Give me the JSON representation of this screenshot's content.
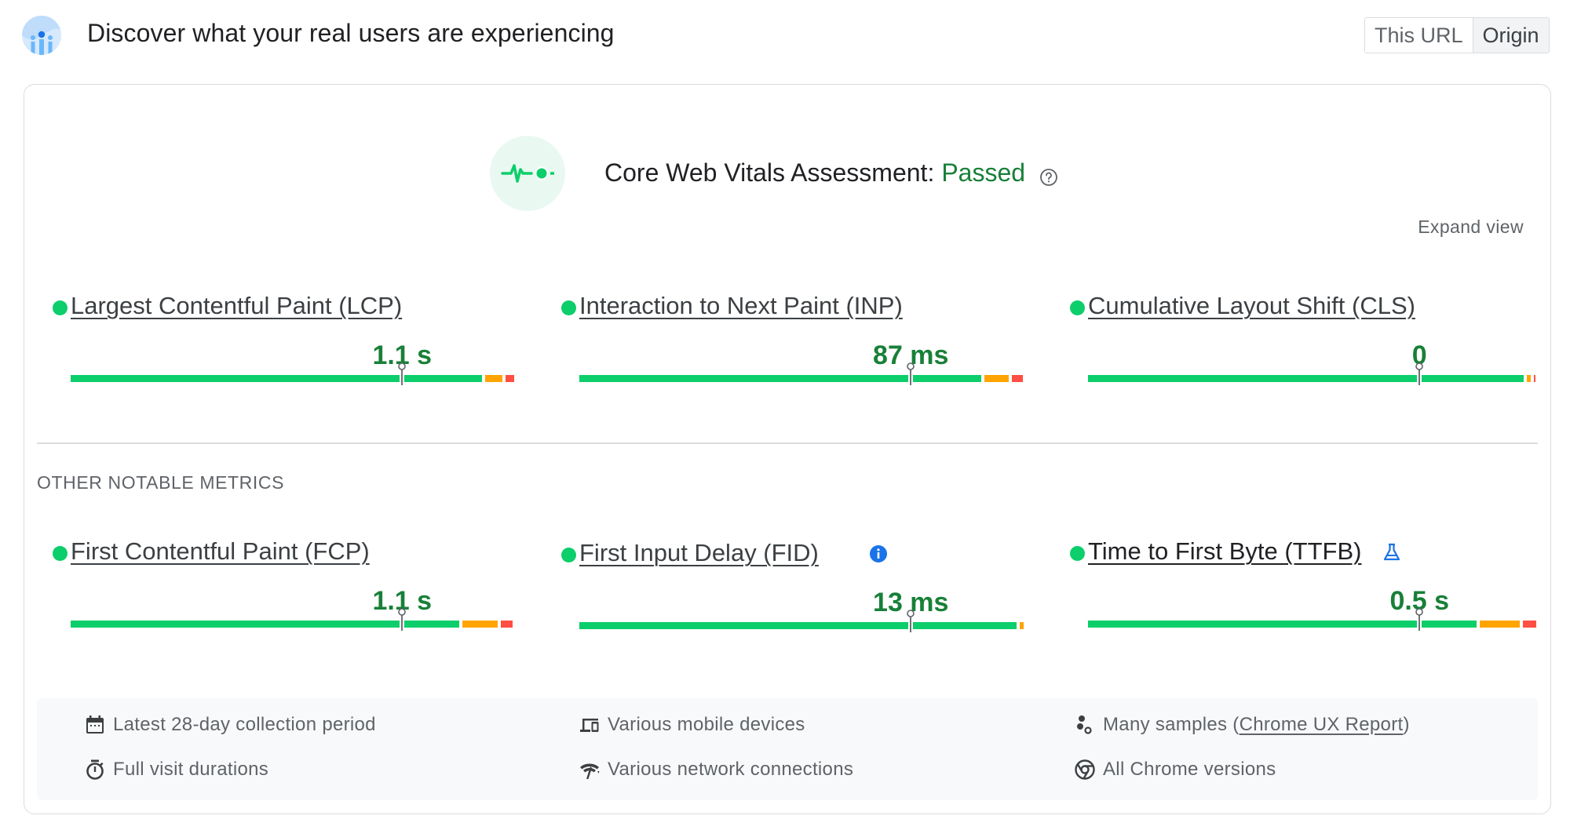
{
  "header": {
    "title": "Discover what your real users are experiencing",
    "logo_icon": "crux-users-icon",
    "toggle": [
      {
        "label": "This URL",
        "active": false
      },
      {
        "label": "Origin",
        "active": true
      }
    ]
  },
  "assessment": {
    "icon": "pulse-icon",
    "label": "Core Web Vitals Assessment:",
    "status": "Passed",
    "status_color": "#188038",
    "help_icon": "help-circle-icon",
    "expand_label": "Expand view"
  },
  "colors": {
    "good": "#0cce6b",
    "needs_improvement": "#ffa400",
    "poor": "#ff4e42",
    "value_text": "#188038"
  },
  "core_metrics": [
    {
      "name": "Largest Contentful Paint (LCP)",
      "value": "1.1 s",
      "rating": "good",
      "distribution": {
        "good": 0.93,
        "needs_improvement": 0.04,
        "poor": 0.02
      },
      "marker": 0.75
    },
    {
      "name": "Interaction to Next Paint (INP)",
      "value": "87 ms",
      "rating": "good",
      "distribution": {
        "good": 0.91,
        "needs_improvement": 0.055,
        "poor": 0.025
      },
      "marker": 0.75
    },
    {
      "name": "Cumulative Layout Shift (CLS)",
      "value": "0",
      "rating": "good",
      "distribution": {
        "good": 0.985,
        "needs_improvement": 0.01,
        "poor": 0.003
      },
      "marker": 0.75
    }
  ],
  "other_section_title": "OTHER NOTABLE METRICS",
  "other_metrics": [
    {
      "name": "First Contentful Paint (FCP)",
      "value": "1.1 s",
      "rating": "good",
      "distribution": {
        "good": 0.88,
        "needs_improvement": 0.08,
        "poor": 0.025
      },
      "marker": 0.75,
      "extra_icon": null
    },
    {
      "name": "First Input Delay (FID)",
      "value": "13 ms",
      "rating": "good",
      "distribution": {
        "good": 0.99,
        "needs_improvement": 0.008,
        "poor": 0.0
      },
      "marker": 0.75,
      "extra_icon": "info-icon"
    },
    {
      "name": "Time to First Byte (TTFB)",
      "value": "0.5 s",
      "rating": "good",
      "distribution": {
        "good": 0.88,
        "needs_improvement": 0.09,
        "poor": 0.03
      },
      "marker": 0.75,
      "extra_icon": "experimental-flask-icon"
    }
  ],
  "footer": {
    "items": [
      {
        "icon": "calendar-icon",
        "text": "Latest 28-day collection period"
      },
      {
        "icon": "devices-icon",
        "text": "Various mobile devices"
      },
      {
        "icon": "samples-icon",
        "text": "Many samples (",
        "link": "Chrome UX Report",
        "suffix": ")"
      },
      {
        "icon": "stopwatch-icon",
        "text": "Full visit durations"
      },
      {
        "icon": "network-icon",
        "text": "Various network connections"
      },
      {
        "icon": "chrome-icon",
        "text": "All Chrome versions"
      }
    ]
  }
}
